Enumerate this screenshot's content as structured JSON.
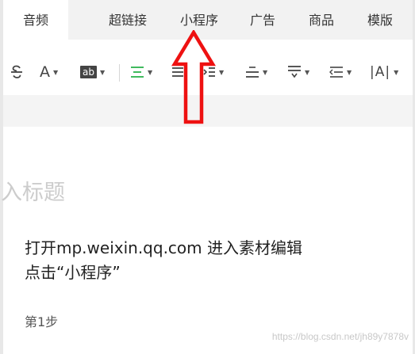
{
  "tabs": [
    {
      "label": "音频",
      "active": true
    },
    {
      "label": "超链接",
      "active": false
    },
    {
      "label": "小程序",
      "active": false
    },
    {
      "label": "广告",
      "active": false
    },
    {
      "label": "商品",
      "active": false
    },
    {
      "label": "模版",
      "active": false
    }
  ],
  "toolbar": {
    "font_color_glyph": "A",
    "bg_color_glyph": "ab",
    "letter_spacing_glyph": "|A|",
    "accent_color": "#2bb24c"
  },
  "editor": {
    "title_placeholder": "输入标题",
    "content_line1": "打开mp.weixin.qq.com 进入素材编辑",
    "content_line2": "点击“小程序”",
    "step_label": "第1步"
  },
  "watermark": "https://blog.csdn.net/jh89y7878v",
  "annotation": {
    "arrow_color": "#ee1111"
  }
}
